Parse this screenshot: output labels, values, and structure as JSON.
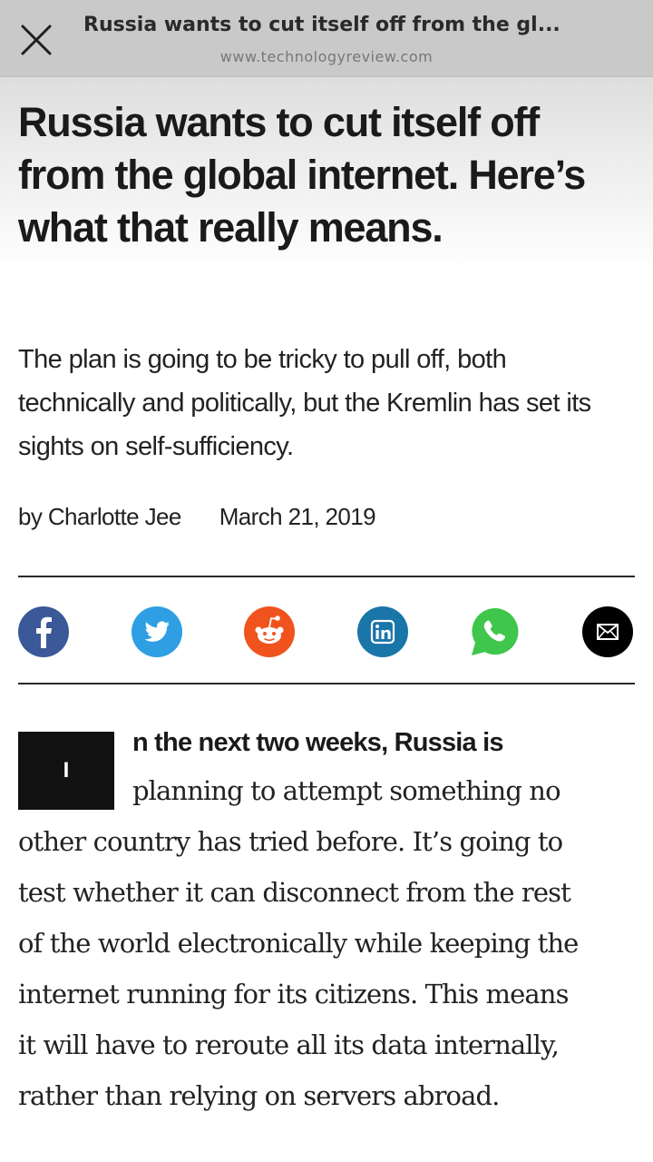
{
  "browser_bar": {
    "title": "Russia wants to cut itself off from the gl...",
    "url": "www.technologyreview.com",
    "close_icon": "close-icon"
  },
  "article": {
    "headline": "Russia wants to cut itself off from the global internet. Here’s what that really means.",
    "dek": "The plan is going to be tricky to pull off, both technically and politically, but the Kremlin has set its sights on self-sufficiency.",
    "author": "by Charlotte Jee",
    "date": "March 21, 2019",
    "dropcap": "I",
    "lead": "n the next two weeks, Russia is",
    "body_lines": [
      "planning to attempt something no",
      "other country has tried before. It’s going to",
      "test whether it can disconnect from the rest",
      "of the world electronically while keeping the",
      "internet running for its citizens. This means",
      "it will have to reroute all its data internally,",
      "rather than relying on servers abroad."
    ]
  },
  "share": [
    {
      "name": "facebook",
      "icon": "facebook-icon",
      "color": "#3b5998"
    },
    {
      "name": "twitter",
      "icon": "twitter-icon",
      "color": "#2f9fe4"
    },
    {
      "name": "reddit",
      "icon": "reddit-icon",
      "color": "#f0531e"
    },
    {
      "name": "linkedin",
      "icon": "linkedin-icon",
      "color": "#1a75a8"
    },
    {
      "name": "whatsapp",
      "icon": "whatsapp-icon",
      "color": "#3fc64b"
    },
    {
      "name": "email",
      "icon": "mail-icon",
      "color": "#000000"
    }
  ]
}
